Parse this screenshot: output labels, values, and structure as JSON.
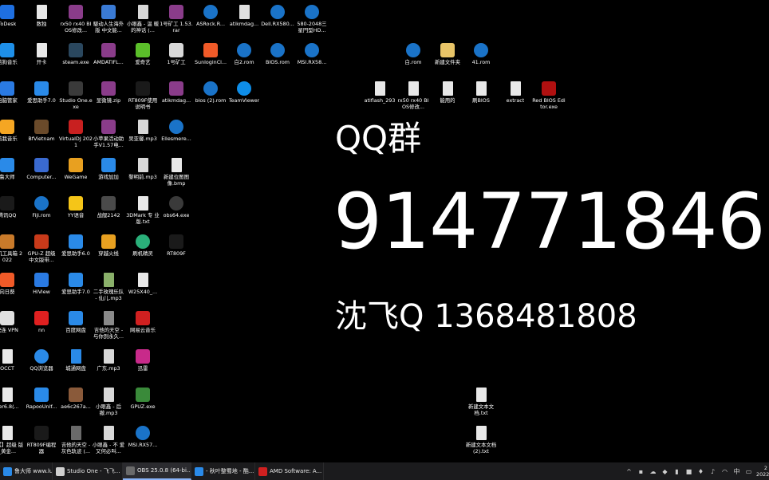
{
  "overlay": {
    "qq_label": "QQ群",
    "qq_number": "914771846",
    "contact": "沈飞Q 1368481808"
  },
  "desktop_icons": [
    {
      "label": "ToDesk",
      "icon": "todesk-icon",
      "color": "#1e6fe0"
    },
    {
      "label": "数独",
      "icon": "file-icon",
      "color": "#e8e8e8"
    },
    {
      "label": "rx50 rx40 BIOS修改...",
      "icon": "winrar-icon",
      "color": "#8a3c8a"
    },
    {
      "label": "駆动人生海外 版 中文能...",
      "icon": "driver-icon",
      "color": "#3a7bd5"
    },
    {
      "label": "小眼鑫 - 温 暖的神话 (...",
      "icon": "mp3-icon",
      "color": "#d8d8d8"
    },
    {
      "label": "1号矿工 1.53.rar",
      "icon": "winrar-icon",
      "color": "#8a3c8a"
    },
    {
      "label": "ASRock.R...",
      "icon": "rom-icon",
      "color": "#1a73c8"
    },
    {
      "label": "atikmdag...",
      "icon": "system-file-icon",
      "color": "#e0e0e0"
    },
    {
      "label": "Dell.RX580...",
      "icon": "rom-icon",
      "color": "#1a73c8"
    },
    {
      "label": "580-2048三 星円型HD...",
      "icon": "rom-icon",
      "color": "#1a73c8"
    },
    {
      "label": "酷狗音乐",
      "icon": "kugou-icon",
      "color": "#1e8fe8"
    },
    {
      "label": "开卡",
      "icon": "file-icon",
      "color": "#e8e8e8"
    },
    {
      "label": "steam.exe",
      "icon": "steam-icon",
      "color": "#2a475e"
    },
    {
      "label": "AMDATIFL...",
      "icon": "winrar-icon",
      "color": "#8a3c8a"
    },
    {
      "label": "爱奇艺",
      "icon": "iqiyi-icon",
      "color": "#5bbf2a"
    },
    {
      "label": "1号矿工",
      "icon": "miner-icon",
      "color": "#d8d8d8"
    },
    {
      "label": "SunloginCl...",
      "icon": "sunlogin-icon",
      "color": "#f05a28"
    },
    {
      "label": "白2.rom",
      "icon": "rom-icon",
      "color": "#1a73c8"
    },
    {
      "label": "BIOS.rom",
      "icon": "rom-icon",
      "color": "#1a73c8"
    },
    {
      "label": "MSI.RX58...",
      "icon": "rom-icon",
      "color": "#1a73c8"
    },
    {
      "label": "白.rom",
      "icon": "rom-icon",
      "color": "#1a73c8"
    },
    {
      "label": "新建文件夹",
      "icon": "folder-icon",
      "color": "#e8c468"
    },
    {
      "label": "41.rom",
      "icon": "rom-icon",
      "color": "#1a73c8"
    },
    {
      "label": "电脑管家",
      "icon": "pc-manager-icon",
      "color": "#2a7ae2"
    },
    {
      "label": "爱思助手7.0",
      "icon": "i4-icon",
      "color": "#2a8ae8"
    },
    {
      "label": "Studio One.exe",
      "icon": "studio-one-icon",
      "color": "#3a3a3a"
    },
    {
      "label": "显微镜.zip",
      "icon": "winrar-icon",
      "color": "#8a3c8a"
    },
    {
      "label": "RT809F使用 说明书",
      "icon": "rt809f-icon",
      "color": "#1a1a1a"
    },
    {
      "label": "atikmdag...",
      "icon": "winrar-icon",
      "color": "#8a3c8a"
    },
    {
      "label": "bios (2).rom",
      "icon": "rom-icon",
      "color": "#1a73c8"
    },
    {
      "label": "TeamViewer",
      "icon": "teamviewer-icon",
      "color": "#0e8ee9"
    },
    {
      "label": "atiflash_293",
      "icon": "file-icon",
      "color": "#e8e8e8"
    },
    {
      "label": "rx50 rx40 BIOS修改...",
      "icon": "file-icon",
      "color": "#e8e8e8"
    },
    {
      "label": "能用的",
      "icon": "file-icon",
      "color": "#e8e8e8"
    },
    {
      "label": "刷BIOS",
      "icon": "file-icon",
      "color": "#e8e8e8"
    },
    {
      "label": "extract",
      "icon": "file-icon",
      "color": "#e8e8e8"
    },
    {
      "label": "Red BIOS Editor.exe",
      "icon": "red-bios-editor-icon",
      "color": "#b01010"
    },
    {
      "label": "酷我音乐",
      "icon": "kuwo-icon",
      "color": "#f5a623"
    },
    {
      "label": "BfVietnam",
      "icon": "bf-icon",
      "color": "#6a4a2a"
    },
    {
      "label": "VirtualDJ 2021",
      "icon": "virtualdj-icon",
      "color": "#c82020"
    },
    {
      "label": "小苹果活动助 手V1.57电...",
      "icon": "winrar-icon",
      "color": "#8a3c8a"
    },
    {
      "label": "吴亚馨.mp3",
      "icon": "mp3-icon",
      "color": "#d8d8d8"
    },
    {
      "label": "Ellesmere...",
      "icon": "rom-icon",
      "color": "#1a73c8"
    },
    {
      "label": "鲁大师",
      "icon": "ludashi-icon",
      "color": "#2a8ae8"
    },
    {
      "label": "Computer...",
      "icon": "computer-icon",
      "color": "#3a6ad0"
    },
    {
      "label": "WeGame",
      "icon": "wegame-icon",
      "color": "#e8a020"
    },
    {
      "label": "游戏加加",
      "icon": "game-plus-icon",
      "color": "#2a8ae8"
    },
    {
      "label": "黎明前.mp3",
      "icon": "mp3-icon",
      "color": "#d8d8d8"
    },
    {
      "label": "新建位图图 像.bmp",
      "icon": "bmp-icon",
      "color": "#e8e8e8"
    },
    {
      "label": "腾讯QQ",
      "icon": "qq-icon",
      "color": "#1a1a1a"
    },
    {
      "label": "Fiji.rom",
      "icon": "rom-icon",
      "color": "#1a73c8"
    },
    {
      "label": "YY语音",
      "icon": "yy-icon",
      "color": "#f5c518"
    },
    {
      "label": "战舰2142",
      "icon": "game-icon",
      "color": "#4a4a4a"
    },
    {
      "label": "3DMark 专 业版.txt",
      "icon": "txt-icon",
      "color": "#e8e8e8"
    },
    {
      "label": "obs64.exe",
      "icon": "obs-icon",
      "color": "#3a3a3a"
    },
    {
      "label": "装机工具箱 2022",
      "icon": "toolbox-icon",
      "color": "#c87a2a"
    },
    {
      "label": "GPU-Z 超级 中文版带...",
      "icon": "gpuz-icon",
      "color": "#c83a1a"
    },
    {
      "label": "爱思助手6.0",
      "icon": "i4-icon",
      "color": "#2a8ae8"
    },
    {
      "label": "穿越火线",
      "icon": "cf-icon",
      "color": "#e8a020"
    },
    {
      "label": "刷机精灵",
      "icon": "flash-icon",
      "color": "#2ab07a"
    },
    {
      "label": "RT809F",
      "icon": "rt809f-icon",
      "color": "#1a1a1a"
    },
    {
      "label": "向日葵",
      "icon": "sunflower-icon",
      "color": "#f05a28"
    },
    {
      "label": "HiView",
      "icon": "hiview-icon",
      "color": "#2a7ae2"
    },
    {
      "label": "爱思助手7.0",
      "icon": "i4-icon",
      "color": "#2a8ae8"
    },
    {
      "label": "二手玫瑰乐队 - 仙儿.mp3",
      "icon": "mp3-icon",
      "color": "#8ab06a"
    },
    {
      "label": "W25X40_...",
      "icon": "file-icon",
      "color": "#e8e8e8"
    },
    {
      "label": "快连 VPN",
      "icon": "vpn-icon",
      "color": "#e0e0e0"
    },
    {
      "label": "nn",
      "icon": "nn-icon",
      "color": "#e02020"
    },
    {
      "label": "百度网盘",
      "icon": "baidu-netdisk-icon",
      "color": "#2a8ae8"
    },
    {
      "label": "吉他的天空 - 与你到永久...",
      "icon": "mp3-icon",
      "color": "#8a8a8a"
    },
    {
      "label": "网易云音乐",
      "icon": "netease-music-icon",
      "color": "#d02020"
    },
    {
      "label": "OCCT",
      "icon": "file-icon",
      "color": "#e8e8e8"
    },
    {
      "label": "QQ浏览器",
      "icon": "qq-browser-icon",
      "color": "#2a8ae8"
    },
    {
      "label": "城通网盘",
      "icon": "ctfile-icon",
      "color": "#2a8ae8"
    },
    {
      "label": "广东.mp3",
      "icon": "mp3-icon",
      "color": "#d8d8d8"
    },
    {
      "label": "迅雷",
      "icon": "xunlei-icon",
      "color": "#c82a8a"
    },
    {
      "label": "ger6.8(...",
      "icon": "file-icon",
      "color": "#e8e8e8"
    },
    {
      "label": "RapooUnif...",
      "icon": "rapoo-icon",
      "color": "#2a8ae8"
    },
    {
      "label": "ae6c267a...",
      "icon": "image-icon",
      "color": "#8a5a3a"
    },
    {
      "label": "小眼鑫 - 后 撤.mp3",
      "icon": "mp3-icon",
      "color": "#d8d8d8"
    },
    {
      "label": "GPUZ.exe",
      "icon": "gpuz-icon",
      "color": "#3a8a3a"
    },
    {
      "label": "新建文本文 档.txt",
      "icon": "txt-icon",
      "color": "#e8e8e8"
    },
    {
      "label": "加【】超级 版_黄金...",
      "icon": "file-icon",
      "color": "#e8e8e8"
    },
    {
      "label": "RT809F编程 器",
      "icon": "rt809f-icon",
      "color": "#1a1a1a"
    },
    {
      "label": "吉他的天空 - 灰色轨迹 (...",
      "icon": "mp3-icon",
      "color": "#6a6a6a"
    },
    {
      "label": "小眼鑫 - 不 爱又何必叫...",
      "icon": "mp3-icon",
      "color": "#d8d8d8"
    },
    {
      "label": "MSI.RX57...",
      "icon": "rom-icon",
      "color": "#1a73c8"
    },
    {
      "label": "新建文本文档 (2).txt",
      "icon": "txt-icon",
      "color": "#e8e8e8"
    }
  ],
  "taskbar": {
    "items": [
      {
        "label": "鲁大师 www.ludas...",
        "icon": "ludashi-icon",
        "color": "#2a8ae8",
        "active": false
      },
      {
        "label": "Studio One - 飞飞...",
        "icon": "studio-one-icon",
        "color": "#cfcfcf",
        "active": false
      },
      {
        "label": "OBS 25.0.8 (64-bi...",
        "icon": "obs-icon",
        "color": "#6a6a6a",
        "active": true
      },
      {
        "label": "- 秋叶整蜀地 - 酷...",
        "icon": "kugou-icon",
        "color": "#2a8ae8",
        "active": false
      },
      {
        "label": "AMD Software: A...",
        "icon": "amd-icon",
        "color": "#d02020",
        "active": false
      }
    ],
    "tray_icons": [
      "chevron-up-icon",
      "network-icon",
      "cloud-icon",
      "shield-icon",
      "battery-icon",
      "app-tray-icon",
      "microphone-icon",
      "speaker-icon",
      "wifi-icon",
      "ime-icon",
      "keyboard-icon"
    ],
    "ime_label": "中",
    "clock_time": "2",
    "clock_date": "2022"
  }
}
